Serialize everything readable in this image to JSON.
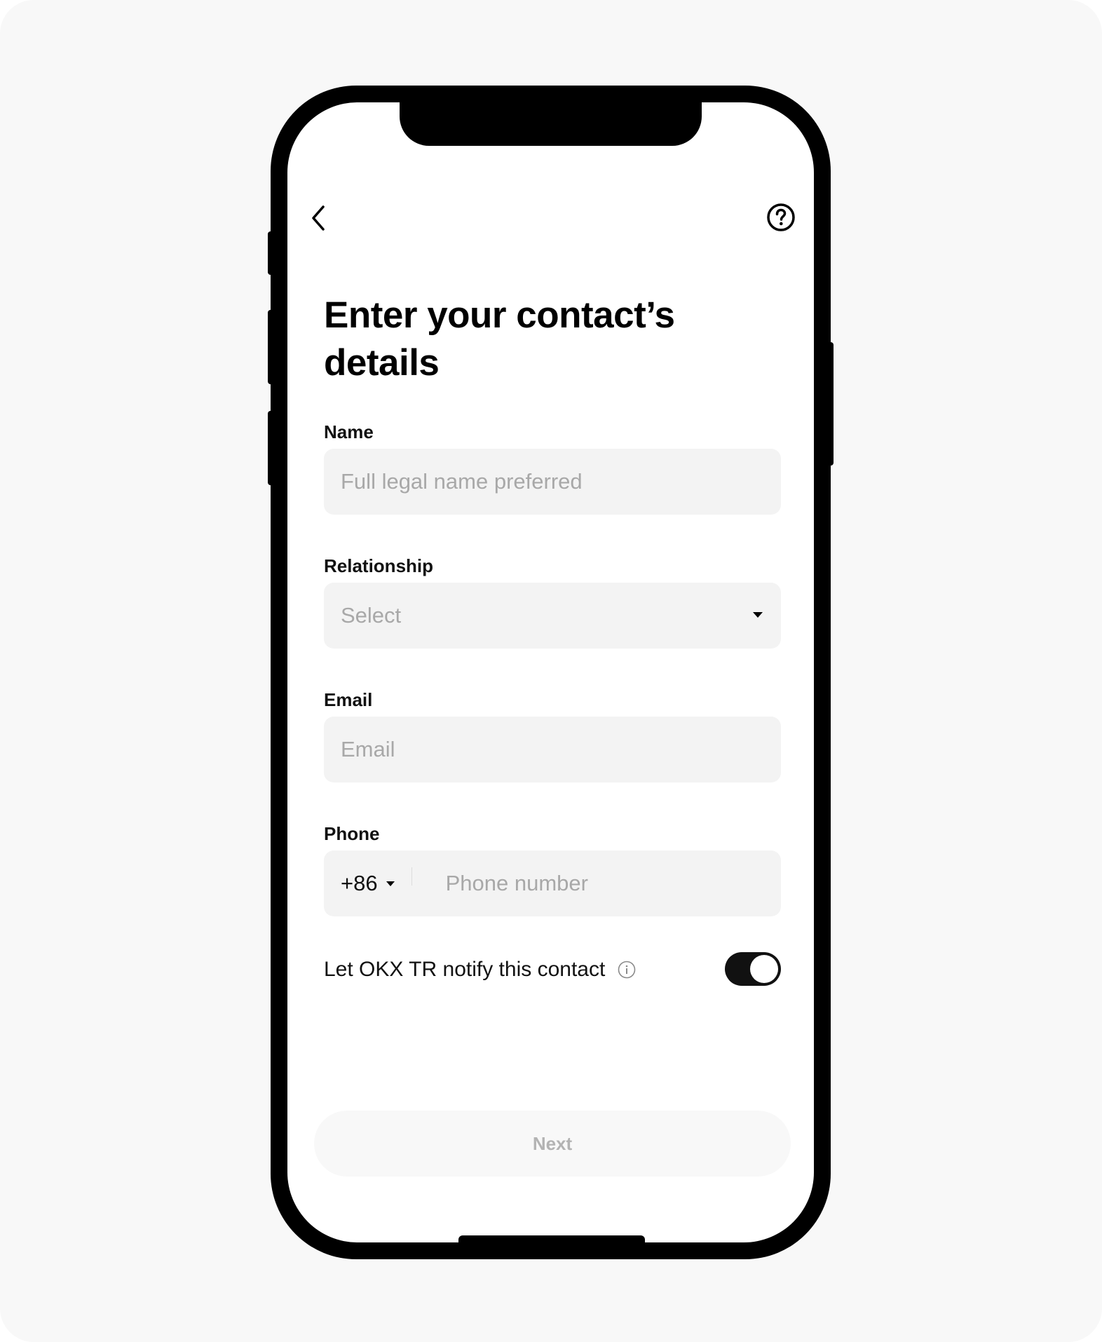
{
  "header": {
    "back_icon": "chevron-left-icon",
    "help_icon": "question-circle-icon"
  },
  "page": {
    "title": "Enter your contact’s details"
  },
  "form": {
    "name": {
      "label": "Name",
      "placeholder": "Full legal name preferred"
    },
    "relationship": {
      "label": "Relationship",
      "placeholder": "Select"
    },
    "email": {
      "label": "Email",
      "placeholder": "Email"
    },
    "phone": {
      "label": "Phone",
      "country_code": "+86",
      "placeholder": "Phone number"
    }
  },
  "notify": {
    "label": "Let OKX TR notify this contact",
    "info_icon": "info-circle-icon",
    "enabled": true
  },
  "footer": {
    "next_label": "Next"
  },
  "colors": {
    "field_bg": "#f3f3f3",
    "placeholder": "#a8a8a8",
    "toggle_on": "#111111",
    "next_disabled_text": "#b3b3b3"
  }
}
